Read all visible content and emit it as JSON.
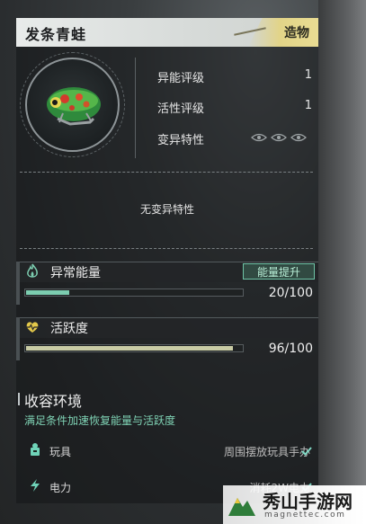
{
  "header": {
    "title": "发条青蛙",
    "badge": "造物"
  },
  "stats": [
    {
      "label": "异能评级",
      "value": "1"
    },
    {
      "label": "活性评级",
      "value": "1"
    },
    {
      "label": "变异特性",
      "value": ""
    }
  ],
  "trait_text": "无变异特性",
  "energy": {
    "label": "异常能量",
    "button": "能量提升",
    "value_text": "20/100",
    "fraction": 0.2,
    "color": "#7ccdb0"
  },
  "activity": {
    "label": "活跃度",
    "value_text": "96/100",
    "fraction": 0.96,
    "color": "#c9cca5"
  },
  "containment": {
    "title": "收容环境",
    "subtitle": "满足条件加速恢复能量与活跃度",
    "requirements": [
      {
        "icon": "toy-icon",
        "name": "玩具",
        "condition": "周围摆放玩具手办"
      },
      {
        "icon": "lightning-icon",
        "name": "电力",
        "condition": "消耗2W电力"
      }
    ]
  },
  "watermark": {
    "title": "秀山手游网",
    "url": "magnettec.com"
  }
}
